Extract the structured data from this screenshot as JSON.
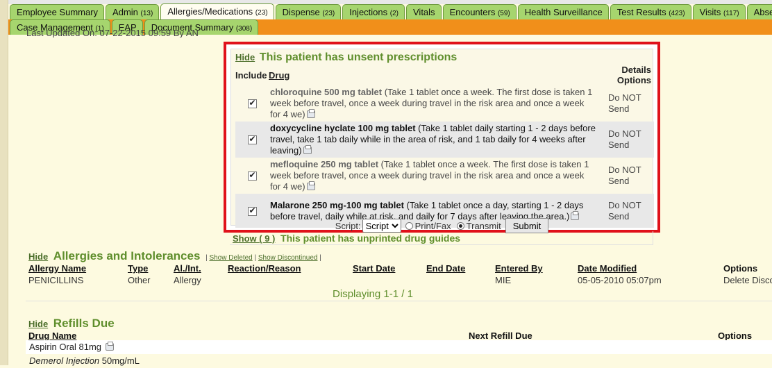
{
  "tabs_row1": [
    {
      "label": "Employee Summary",
      "count": ""
    },
    {
      "label": "Admin",
      "count": "(13)"
    },
    {
      "label": "Allergies/Medications",
      "count": "(23)",
      "active": true
    },
    {
      "label": "Dispense",
      "count": "(23)"
    },
    {
      "label": "Injections",
      "count": "(2)"
    },
    {
      "label": "Vitals",
      "count": ""
    },
    {
      "label": "Encounters",
      "count": "(59)"
    },
    {
      "label": "Health Surveillance",
      "count": ""
    },
    {
      "label": "Test Results",
      "count": "(423)"
    },
    {
      "label": "Visits",
      "count": "(117)"
    },
    {
      "label": "Absence M",
      "count": ""
    }
  ],
  "tabs_row2": [
    {
      "label": "Case Management",
      "count": "(1)"
    },
    {
      "label": "EAP",
      "count": ""
    },
    {
      "label": "Document Summary",
      "count": "(308)"
    }
  ],
  "last_updated": "Last Updated On: 07-22-2015 09:59 By AN",
  "prescriptions": {
    "hide_label": "Hide",
    "title": "This patient has unsent prescriptions",
    "headers": {
      "include": "Include",
      "drug": "Drug",
      "details": "Details",
      "options": "Options"
    },
    "rows": [
      {
        "drug": "chloroquine 500 mg tablet",
        "instructions": " (Take 1 tablet once a week. The first dose is taken 1 week before travel, once a week during travel in the risk area and once a week for 4 we)",
        "option": "Do NOT Send",
        "checked": true
      },
      {
        "drug": "doxycycline hyclate 100 mg tablet",
        "instructions": " (Take 1 tablet daily starting 1 - 2 days before travel, take 1 tab daily while in the area of risk, and 1 tab daily for 4 weeks after leaving)",
        "option": "Do NOT Send",
        "checked": true
      },
      {
        "drug": "mefloquine 250 mg tablet",
        "instructions": " (Take 1 tablet once a week. The first dose is taken 1 week before travel, once a week during travel in the risk area and once a week for 4 we)",
        "option": "Do NOT Send",
        "checked": true
      },
      {
        "drug": "Malarone 250 mg-100 mg tablet",
        "instructions": " (Take 1 tablet once a day, starting 1 - 2 days before travel, daily while at risk, and daily for 7 days after leaving the area.)",
        "option": "Do NOT Send",
        "checked": true
      }
    ],
    "footer": {
      "script_label": "Script:",
      "script_value": "Script",
      "print_fax": "Print/Fax",
      "transmit": "Transmit",
      "submit": "Submit"
    }
  },
  "drug_guides": {
    "show_label": "Show ( 9 )",
    "title": "This patient has unprinted drug guides"
  },
  "allergies": {
    "hide_label": "Hide",
    "title": "Allergies and Intolerances",
    "show_deleted": "Show Deleted",
    "show_discontinued": "Show Discontinued",
    "headers": {
      "name": "Allergy Name",
      "type": "Type",
      "al_int": "Al./Int.",
      "reaction": "Reaction/Reason",
      "start": "Start Date",
      "end": "End Date",
      "entered": "Entered By",
      "modified": "Date Modified",
      "options": "Options"
    },
    "row": {
      "name": "PENICILLINS",
      "type": "Other",
      "al_int": "Allergy",
      "reaction": "",
      "start": "",
      "end": "",
      "entered": "MIE",
      "modified": "05-05-2010 05:07pm",
      "options": "Delete Disco"
    },
    "displaying": "Displaying 1-1 / 1"
  },
  "refills": {
    "hide_label": "Hide",
    "title": "Refills Due",
    "headers": {
      "drug": "Drug Name",
      "next": "Next Refill Due",
      "options": "Options"
    },
    "rows": [
      {
        "drug": "Aspirin Oral 81mg",
        "dose": ""
      },
      {
        "drug": "Demerol Injection",
        "dose": " 50mg/mL"
      }
    ]
  }
}
